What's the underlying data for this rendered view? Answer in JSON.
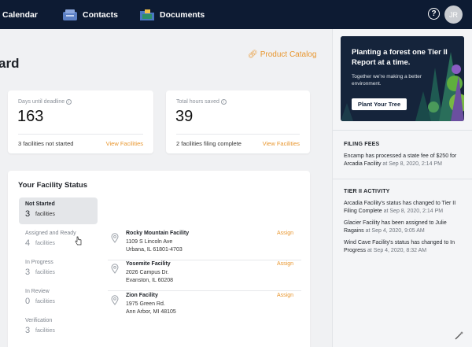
{
  "nav": {
    "items": [
      {
        "label": "Calendar"
      },
      {
        "label": "Contacts"
      },
      {
        "label": "Documents"
      }
    ],
    "avatar_initials": "JR",
    "help_glyph": "?"
  },
  "page": {
    "title": "ard",
    "catalog_link": "Product Catalog"
  },
  "stats": [
    {
      "label": "Days until deadline",
      "value": "163",
      "sub": "3 facilities not started",
      "link": "View Facilities"
    },
    {
      "label": "Total hours saved",
      "value": "39",
      "sub": "2 facilities filing complete",
      "link": "View Facilities"
    }
  ],
  "status": {
    "title": "Your Facility Status",
    "tabs": [
      {
        "name": "Not Started",
        "count": "3",
        "unit": "facilities"
      },
      {
        "name": "Assigned and Ready",
        "count": "4",
        "unit": "facilities"
      },
      {
        "name": "In Progress",
        "count": "3",
        "unit": "facilities"
      },
      {
        "name": "In Review",
        "count": "0",
        "unit": "facilities"
      },
      {
        "name": "Verification",
        "count": "3",
        "unit": "facilities"
      }
    ],
    "facilities": [
      {
        "name": "Rocky Mountain Facility",
        "line1": "1109 S Lincoln Ave",
        "line2": "Urbana, IL 61801-4703",
        "action": "Assign"
      },
      {
        "name": "Yosemite Facility",
        "line1": "2026 Campus Dr.",
        "line2": "Evanston, IL 60208",
        "action": "Assign"
      },
      {
        "name": "Zion Facility",
        "line1": "1975 Green Rd.",
        "line2": "Ann Arbor, MI 48105",
        "action": "Assign"
      }
    ]
  },
  "sidebar": {
    "promo": {
      "title": "Planting a forest one Tier II Report at a time.",
      "text": "Together we're making a better environment.",
      "button": "Plant Your Tree"
    },
    "filing_fees": {
      "heading": "FILING FEES",
      "text": "Encamp has processed a state fee of $250 for Arcadia Facility",
      "time": "at Sep 8, 2020, 2:14 PM"
    },
    "activity": {
      "heading": "TIER II ACTIVITY",
      "items": [
        {
          "text": "Arcadia Facility's status has changed to Tier II Filing Complete",
          "time": "at Sep 8, 2020, 2:14 PM"
        },
        {
          "text": "Glacier Facility has been assigned to Julie Ragains",
          "time": "at Sep 4, 2020, 9:05 AM"
        },
        {
          "text": "Wind Cave Facility's status has changed to In Progress",
          "time": "at Sep 4, 2020, 8:32 AM"
        }
      ]
    }
  },
  "colors": {
    "nav_bg": "#0d1b33",
    "accent": "#e8962e",
    "promo_bg": "#15243b"
  }
}
